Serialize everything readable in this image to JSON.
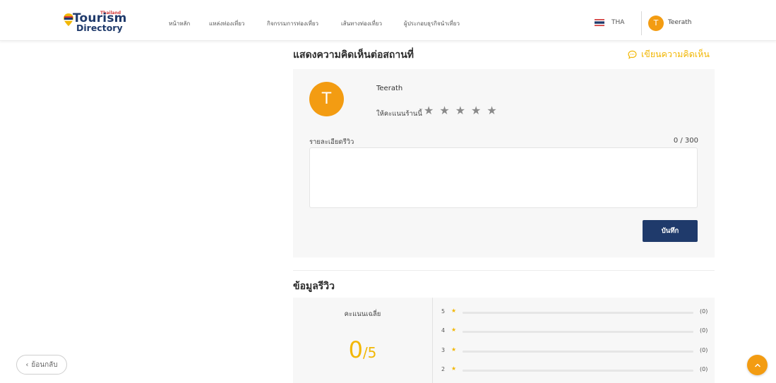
{
  "header": {
    "logo": {
      "small": "Thailand",
      "big": "Tourism",
      "sub": "Directory"
    },
    "nav": [
      {
        "label": "หน้าหลัก"
      },
      {
        "label": "แหล่งท่องเที่ยว"
      },
      {
        "label": "กิจกรรมการท่องเที่ยว"
      },
      {
        "label": "เส้นทางท่องเที่ยว"
      },
      {
        "label": "ผู้ประกอบธุรกิจนำเที่ยว"
      }
    ],
    "lang": "THA",
    "user": {
      "initial": "T",
      "name": "Teerath"
    }
  },
  "comment_section": {
    "title": "แสดงความคิดเห็นต่อสถานที่",
    "write_link": "เขียนความคิดเห็น"
  },
  "review_form": {
    "avatar_initial": "T",
    "user_name": "Teerath",
    "rate_label": "ให้คะแนนร้านนี้",
    "stars": [
      "★",
      "★",
      "★",
      "★",
      "★"
    ],
    "detail_label": "รายละเอียดรีวิว",
    "counter": "0 / 300",
    "textarea_value": "",
    "save_label": "บันทึก"
  },
  "review_info": {
    "title": "ข้อมูลรีวิว",
    "avg_label": "คะแนนเฉลี่ย",
    "avg_value": "0",
    "avg_max": "/5",
    "rows": [
      {
        "stars": "5",
        "count": "(0)",
        "fraction": 0
      },
      {
        "stars": "4",
        "count": "(0)",
        "fraction": 0
      },
      {
        "stars": "3",
        "count": "(0)",
        "fraction": 0
      },
      {
        "stars": "2",
        "count": "(0)",
        "fraction": 0
      }
    ]
  },
  "back_label": "ย้อนกลับ",
  "colors": {
    "accent": "#f2b705",
    "avatar": "#f39c12",
    "primary": "#1f3a6b"
  }
}
